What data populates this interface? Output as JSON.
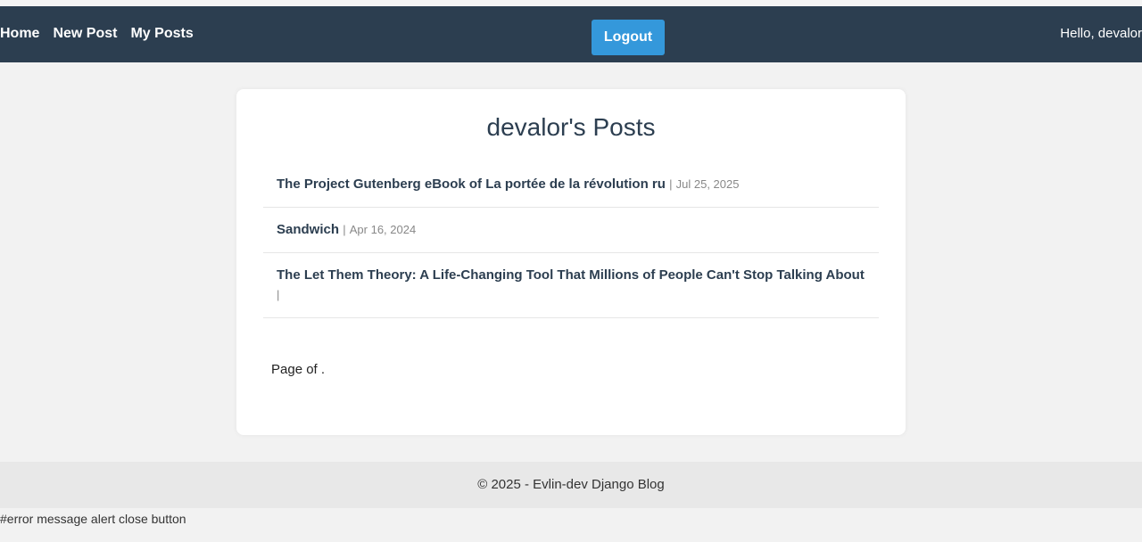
{
  "nav": {
    "links": [
      {
        "label": "Home"
      },
      {
        "label": "New Post"
      },
      {
        "label": "My Posts"
      }
    ],
    "logout_label": "Logout",
    "greeting": "Hello, devalor"
  },
  "main": {
    "heading": "devalor's Posts",
    "posts": [
      {
        "title": "The Project Gutenberg eBook of La portée de la révolution ru",
        "separator": "|",
        "date": "Jul 25, 2025"
      },
      {
        "title": "Sandwich",
        "separator": "|",
        "date": "Apr 16, 2024"
      },
      {
        "title": "The Let Them Theory: A Life-Changing Tool That Millions of People Can't Stop Talking About",
        "separator": "|",
        "date": ""
      }
    ],
    "pagination_text": "Page of ."
  },
  "footer": {
    "text": "© 2025 - Evlin-dev Django Blog"
  },
  "error_text": "#error message alert close button",
  "colors": {
    "navbar_bg": "#2c3e50",
    "button_bg": "#3498db",
    "page_bg": "#f2f2f2",
    "footer_bg": "#e8e8e8"
  }
}
